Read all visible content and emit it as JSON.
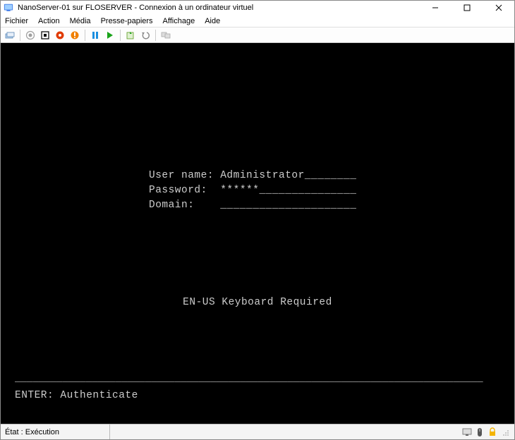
{
  "window": {
    "title": "NanoServer-01 sur FLOSERVER - Connexion à un ordinateur virtuel"
  },
  "menu": {
    "fichier": "Fichier",
    "action": "Action",
    "media": "Média",
    "presse_papiers": "Presse-papiers",
    "affichage": "Affichage",
    "aide": "Aide"
  },
  "login": {
    "username_label": "User name:",
    "username_value": "Administrator",
    "username_pad": "________",
    "password_label": "Password:",
    "password_value": "******",
    "password_pad": "_______________",
    "domain_label": "Domain:",
    "domain_value": "",
    "domain_pad": "_____________________"
  },
  "kbd_msg": "EN-US Keyboard Required",
  "rule": "_______________________________________________________________________________",
  "enter_line": "ENTER: Authenticate",
  "status": {
    "text": "État : Exécution"
  }
}
